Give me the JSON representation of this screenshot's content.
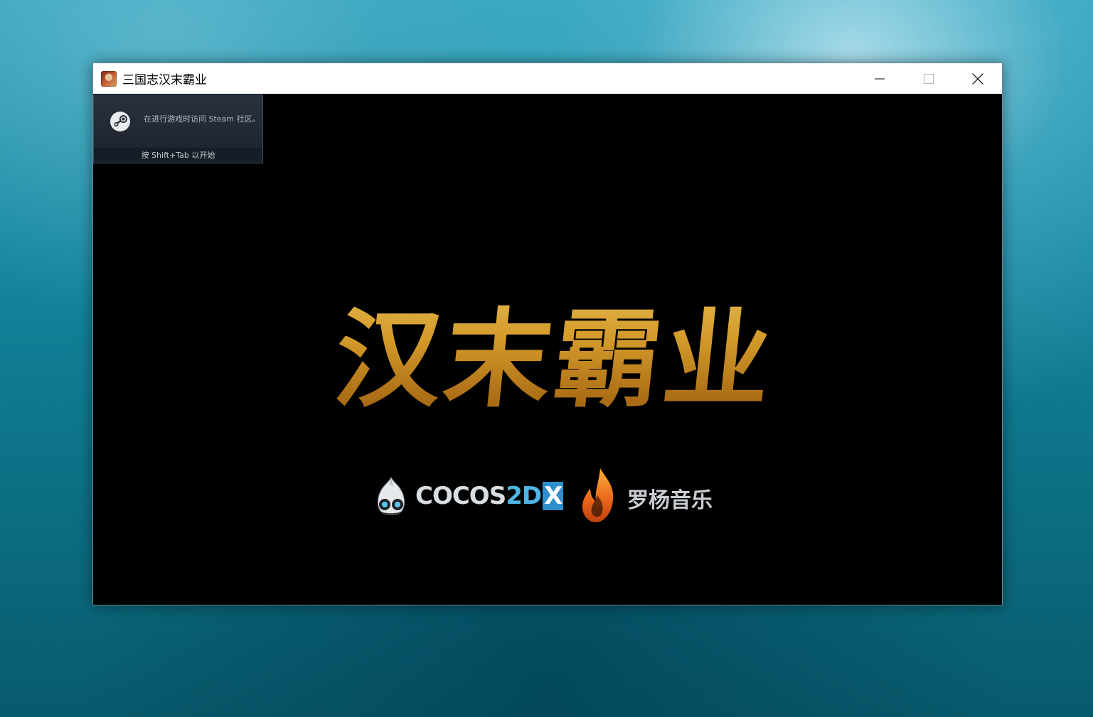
{
  "window": {
    "title": "三国志汉末霸业",
    "app_icon": "game-portrait-icon",
    "controls": {
      "minimize": "minimize-icon",
      "maximize": "maximize-icon",
      "close": "close-icon"
    }
  },
  "steam_overlay": {
    "message": "在进行游戏时访问 Steam 社区。",
    "hint": "按 Shift+Tab 以开始",
    "icon": "steam-icon"
  },
  "splash": {
    "title_calligraphy": "汉末霸业",
    "title_color": "#d4a22e",
    "logos": {
      "engine": {
        "part1": "COCOS",
        "part2": "2D",
        "part3": "X",
        "icon": "cocos-mascot-icon"
      },
      "music": {
        "text": "罗杨音乐",
        "icon": "flame-icon"
      }
    }
  }
}
